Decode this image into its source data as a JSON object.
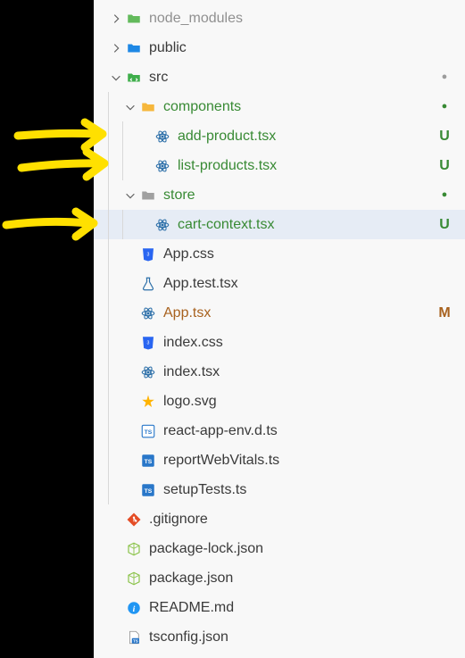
{
  "tree": {
    "node_modules": {
      "label": "node_modules",
      "status": ""
    },
    "public": {
      "label": "public",
      "status": ""
    },
    "src": {
      "label": "src",
      "status": "dot",
      "components": {
        "label": "components",
        "status": "dotg",
        "add_product": {
          "label": "add-product.tsx",
          "status": "U"
        },
        "list_products": {
          "label": "list-products.tsx",
          "status": "U"
        }
      },
      "store": {
        "label": "store",
        "status": "dotg",
        "cart_context": {
          "label": "cart-context.tsx",
          "status": "U"
        }
      },
      "app_css": {
        "label": "App.css",
        "status": ""
      },
      "app_test": {
        "label": "App.test.tsx",
        "status": ""
      },
      "app_tsx": {
        "label": "App.tsx",
        "status": "M"
      },
      "index_css": {
        "label": "index.css",
        "status": ""
      },
      "index_tsx": {
        "label": "index.tsx",
        "status": ""
      },
      "logo_svg": {
        "label": "logo.svg",
        "status": ""
      },
      "react_env": {
        "label": "react-app-env.d.ts",
        "status": ""
      },
      "report_vitals": {
        "label": "reportWebVitals.ts",
        "status": ""
      },
      "setup_tests": {
        "label": "setupTests.ts",
        "status": ""
      }
    },
    "gitignore": {
      "label": ".gitignore",
      "status": ""
    },
    "pkg_lock": {
      "label": "package-lock.json",
      "status": ""
    },
    "pkg": {
      "label": "package.json",
      "status": ""
    },
    "readme": {
      "label": "README.md",
      "status": ""
    },
    "tsconfig": {
      "label": "tsconfig.json",
      "status": ""
    }
  },
  "status_glyph": {
    "U": "U",
    "M": "M",
    "dot": "●",
    "dotg": "●",
    "": ""
  }
}
